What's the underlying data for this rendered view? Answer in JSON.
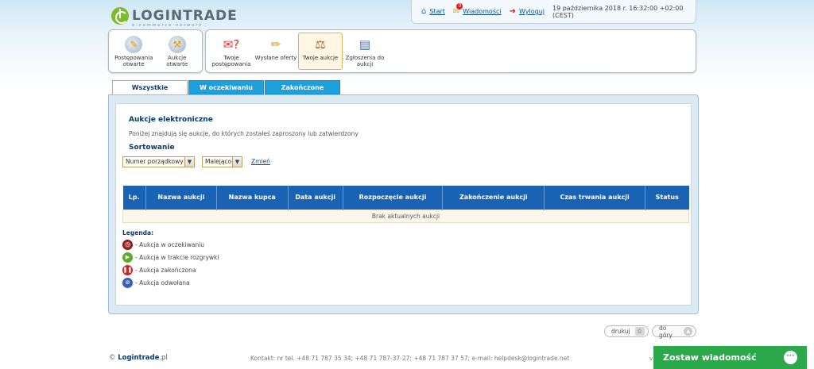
{
  "brand": {
    "name": "LOGINTRADE",
    "tagline": "e-commerce network"
  },
  "topbar": {
    "start": "Start",
    "messages": "Wiadomości",
    "messages_count": "0",
    "logout": "Wyloguj",
    "datetime": "19 października 2018 r. 16:32:00 +02:00 (CEST)"
  },
  "nav_left": [
    {
      "label": "Postępowania otwarte"
    },
    {
      "label": "Aukcje otwarte"
    }
  ],
  "nav_right": [
    {
      "label": "Twoje postępowania"
    },
    {
      "label": "Wysłane oferty"
    },
    {
      "label": "Twoje aukcje"
    },
    {
      "label": "Zgłoszenia do aukcji"
    }
  ],
  "tabs": [
    {
      "label": "Wszystkie"
    },
    {
      "label": "W oczekiwaniu"
    },
    {
      "label": "Zakończone"
    }
  ],
  "main": {
    "title": "Aukcje elektroniczne",
    "description": "Poniżej znajdują się aukcje, do których zostałeś zaproszony lub zatwierdzony",
    "sort_title": "Sortowanie",
    "sort_field": "Numer porządkowy",
    "sort_order": "Malejąco",
    "change": "Zmień"
  },
  "table": {
    "columns": [
      "Lp.",
      "Nazwa aukcji",
      "Nazwa kupca",
      "Data aukcji",
      "Rozpoczęcie aukcji",
      "Zakończenie aukcji",
      "Czas trwania aukcji",
      "Status"
    ],
    "empty": "Brak aktualnych aukcji"
  },
  "legend": {
    "title": "Legenda:",
    "items": [
      "- Aukcja w oczekiwaniu",
      "- Aukcja w trakcie rozgrywki",
      "- Aukcja zakończona",
      "- Aukcja odwołana"
    ]
  },
  "bottom": {
    "print": "drukuj",
    "top": "do góry"
  },
  "footer": {
    "copy_symbol": "©",
    "copy_brand": "Logintrade",
    "copy_domain": ".pl",
    "contact": "Kontakt: nr tel. +48 71 787 35 34; +48 71 787-37-27; +48 71 787 37 57; e-mail: helpdesk@logintrade.net",
    "v": "v"
  },
  "chat": {
    "label": "Zostaw wiadomość"
  }
}
